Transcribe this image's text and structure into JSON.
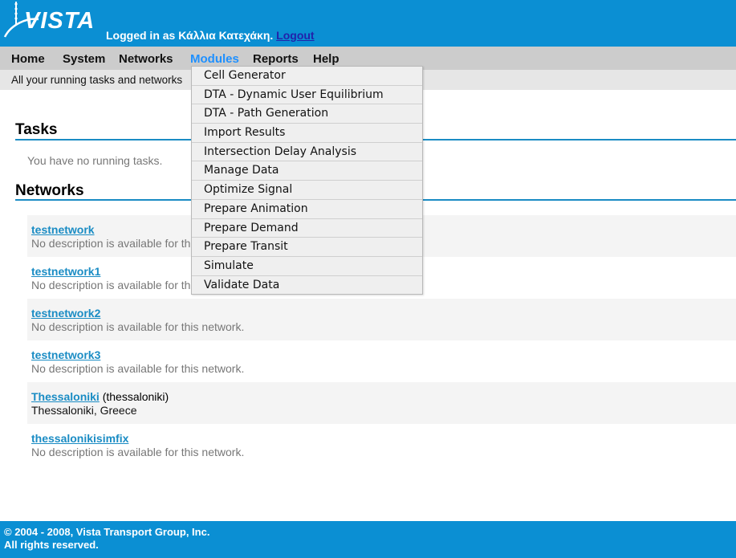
{
  "header": {
    "logo_text": "VISTA",
    "logged_in_prefix": "Logged in as Κάλλια Κατεχάκη.",
    "logout_label": "Logout"
  },
  "nav": {
    "items": [
      "Home",
      "System",
      "Networks",
      "Modules",
      "Reports",
      "Help"
    ],
    "active": "Modules"
  },
  "subnav": {
    "text": "All your running tasks and networks"
  },
  "tasks": {
    "title": "Tasks",
    "empty_message": "You have no running tasks."
  },
  "networks": {
    "title": "Networks",
    "items": [
      {
        "name": "testnetwork",
        "extra": "",
        "description": "No description is available for this network."
      },
      {
        "name": "testnetwork1",
        "extra": "",
        "description": "No description is available for this network."
      },
      {
        "name": "testnetwork2",
        "extra": "",
        "description": "No description is available for this network."
      },
      {
        "name": "testnetwork3",
        "extra": "",
        "description": "No description is available for this network."
      },
      {
        "name": "Thessaloniki",
        "extra": "(thessaloniki)",
        "description": "Thessaloniki, Greece"
      },
      {
        "name": "thessalonikisimfix",
        "extra": "",
        "description": "No description is available for this network."
      }
    ]
  },
  "modules_menu": {
    "items": [
      "Cell Generator",
      "DTA - Dynamic User Equilibrium",
      "DTA - Path Generation",
      "Import Results",
      "Intersection Delay Analysis",
      "Manage Data",
      "Optimize Signal",
      "Prepare Animation",
      "Prepare Demand",
      "Prepare Transit",
      "Simulate",
      "Validate Data"
    ]
  },
  "footer": {
    "line1": "© 2004 - 2008, Vista Transport Group, Inc.",
    "line2": "All rights reserved."
  },
  "colors": {
    "header_bg": "#0b8fd3",
    "accent": "#1a8cc4",
    "nav_bg": "#cccccc"
  }
}
